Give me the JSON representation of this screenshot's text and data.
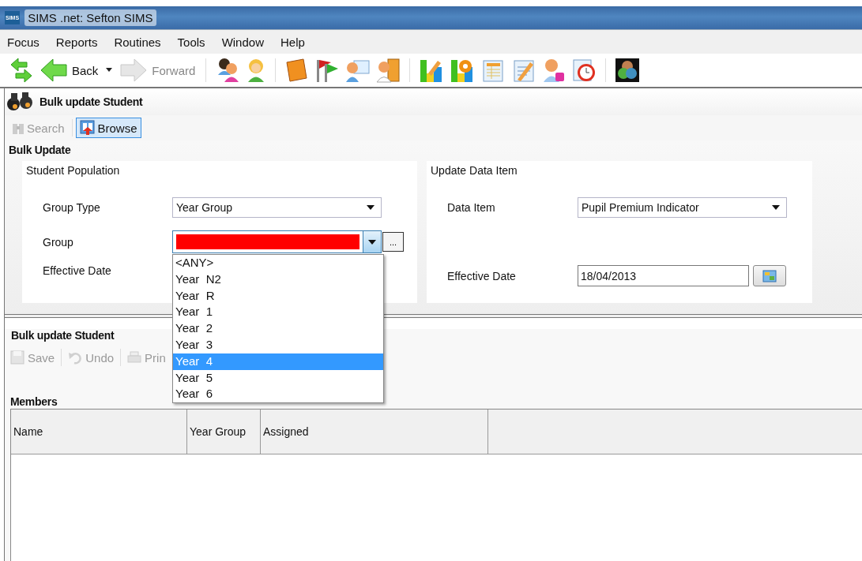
{
  "window": {
    "title": "SIMS .net: Sefton SIMS",
    "app_icon": "SIMS"
  },
  "menu": [
    {
      "label": "Focus"
    },
    {
      "label": "Reports"
    },
    {
      "label": "Routines"
    },
    {
      "label": "Tools"
    },
    {
      "label": "Window"
    },
    {
      "label": "Help"
    }
  ],
  "nav": {
    "back": "Back",
    "forward": "Forward",
    "forward_disabled": true
  },
  "page_header": "Bulk update Student",
  "mode_tabs": [
    {
      "label": "Search",
      "selected": false,
      "disabled": true
    },
    {
      "label": "Browse",
      "selected": true,
      "disabled": false
    }
  ],
  "bulk_update": {
    "title": "Bulk Update",
    "population": {
      "title": "Student Population",
      "group_type_label": "Group Type",
      "group_type": "Year Group",
      "group_label": "Group",
      "group_invalid": true,
      "effective_date_label": "Effective Date",
      "more_button": "...",
      "group_options": [
        {
          "label": "<ANY>",
          "selected": false
        },
        {
          "label": "Year  N2",
          "selected": false
        },
        {
          "label": "Year  R",
          "selected": false
        },
        {
          "label": "Year  1",
          "selected": false
        },
        {
          "label": "Year  2",
          "selected": false
        },
        {
          "label": "Year  3",
          "selected": false
        },
        {
          "label": "Year  4",
          "selected": true
        },
        {
          "label": "Year  5",
          "selected": false
        },
        {
          "label": "Year  6",
          "selected": false
        }
      ]
    },
    "data_item": {
      "title": "Update Data Item",
      "data_item_label": "Data Item",
      "data_item": "Pupil Premium Indicator",
      "effective_date_label": "Effective Date",
      "effective_date": "18/04/2013"
    }
  },
  "results": {
    "title": "Bulk update Student",
    "actions": [
      {
        "kind": "save",
        "label": "Save",
        "disabled": true
      },
      {
        "kind": "undo",
        "label": "Undo",
        "disabled": true
      },
      {
        "kind": "print",
        "label": "Prin",
        "disabled": true
      }
    ],
    "members": {
      "title": "Members",
      "columns": [
        "Name",
        "Year Group",
        "Assigned"
      ]
    }
  }
}
